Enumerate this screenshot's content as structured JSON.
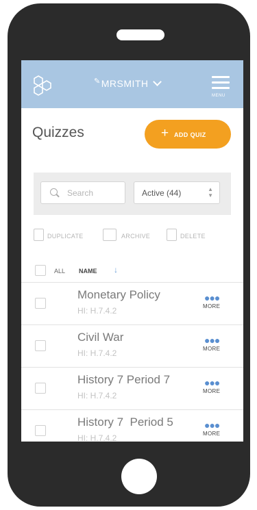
{
  "app": {
    "username": "MRSMITH",
    "menu_label": "MENU",
    "logo_icon": "hexagon-logo-icon",
    "header_color": "#a9c6e2",
    "accent_color": "#f3a020"
  },
  "page": {
    "title": "Quizzes",
    "add_button": "ADD QUIZ"
  },
  "filters": {
    "search_placeholder": "Search",
    "status_value": "Active (44)"
  },
  "actions": [
    {
      "label": "DUPLICATE",
      "icon": "duplicate-icon"
    },
    {
      "label": "ARCHIVE",
      "icon": "archive-icon"
    },
    {
      "label": "DELETE",
      "icon": "trash-icon"
    }
  ],
  "table": {
    "all_label": "ALL",
    "name_header": "NAME",
    "sort_icon": "sort-down-arrow-icon",
    "more_label": "MORE",
    "rows": [
      {
        "title": "Monetary Policy",
        "subtitle": "HI: H.7.4.2"
      },
      {
        "title": "Civil War",
        "subtitle": "HI: H.7.4.2"
      },
      {
        "title": "History 7 Period 7",
        "subtitle": "HI: H.7.4.2"
      },
      {
        "title": "History 7  Period 5",
        "subtitle": "HI: H.7.4.2"
      }
    ]
  }
}
